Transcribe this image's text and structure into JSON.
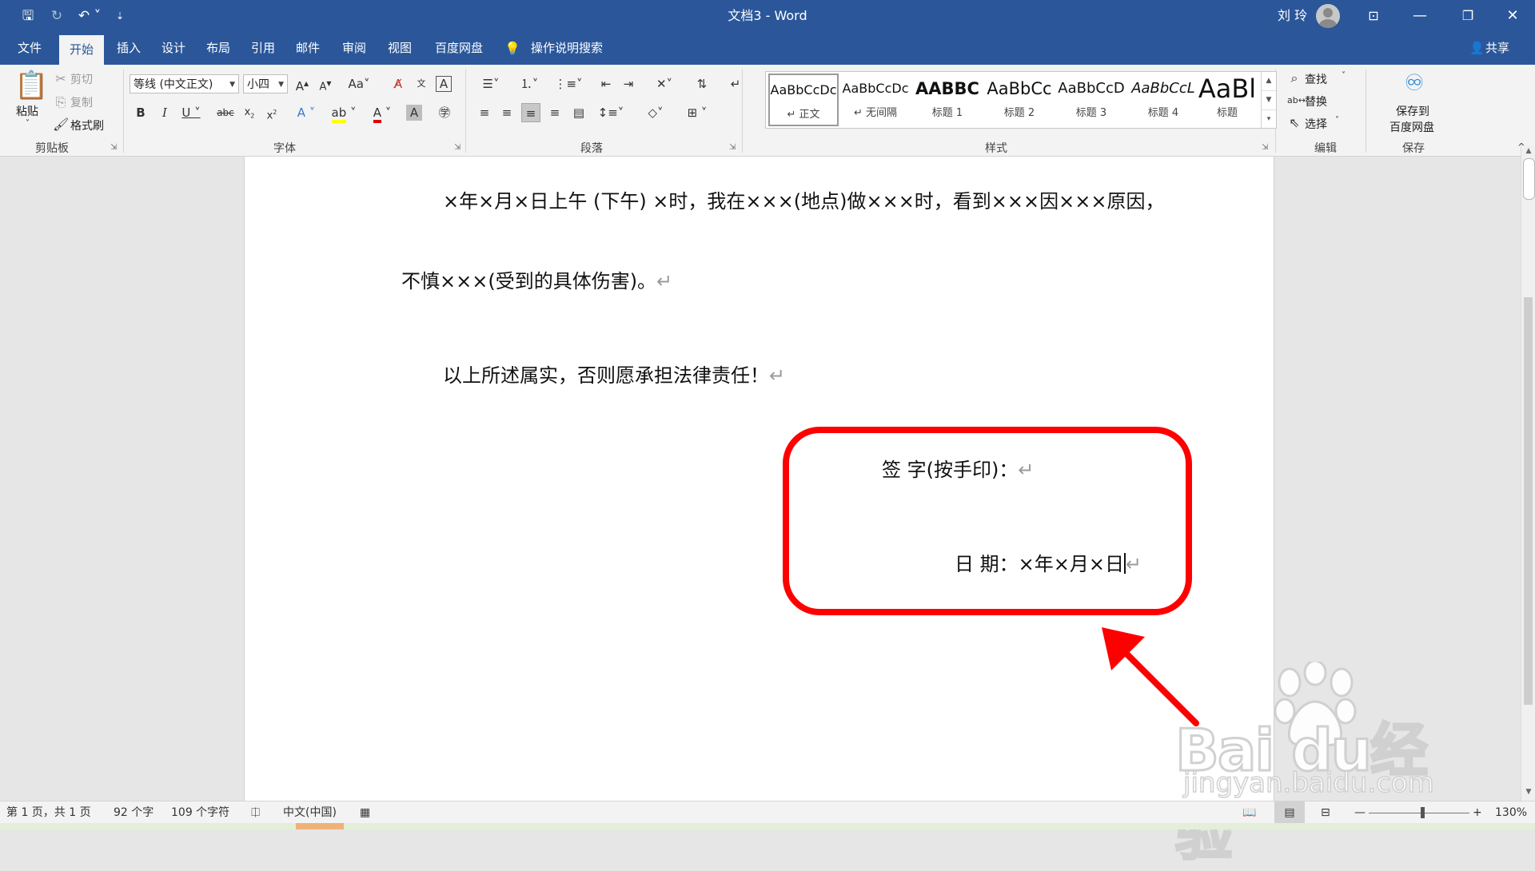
{
  "titlebar": {
    "title": "文档3  -  Word",
    "user": "刘 玲",
    "qat": [
      "save-icon",
      "autosave-icon",
      "undo-icon",
      "customize-icon"
    ],
    "qat_glyphs": {
      "save": "🖫",
      "autosave": "↻",
      "undo": "↶ ˅",
      "customize": "⇣"
    },
    "window_glyphs": {
      "ribbon_options": "⊡",
      "minimize": "—",
      "restore": "❐",
      "close": "✕"
    }
  },
  "tabs": {
    "items": [
      "文件",
      "开始",
      "插入",
      "设计",
      "布局",
      "引用",
      "邮件",
      "审阅",
      "视图",
      "百度网盘"
    ],
    "active": "开始",
    "tell_me": "操作说明搜索",
    "share": "共享"
  },
  "ribbon": {
    "clipboard": {
      "label": "剪贴板",
      "paste": "粘贴",
      "cut": "剪切",
      "copy": "复制",
      "format_painter": "格式刷"
    },
    "font": {
      "label": "字体",
      "font_name": "等线 (中文正文)",
      "font_size": "小四"
    },
    "paragraph": {
      "label": "段落"
    },
    "styles": {
      "label": "样式",
      "items": [
        {
          "preview": "AaBbCcDc",
          "name": "↵ 正文"
        },
        {
          "preview": "AaBbCcDc",
          "name": "↵ 无间隔"
        },
        {
          "preview": "AABBC",
          "name": "标题 1"
        },
        {
          "preview": "AaBbCc",
          "name": "标题 2"
        },
        {
          "preview": "AaBbCcD",
          "name": "标题 3"
        },
        {
          "preview": "AaBbCcL",
          "name": "标题 4"
        },
        {
          "preview": "AaBl",
          "name": "标题"
        }
      ]
    },
    "editing": {
      "label": "编辑",
      "find": "查找",
      "replace": "替换",
      "select": "选择"
    },
    "save": {
      "label": "保存",
      "save_to_line1": "保存到",
      "save_to_line2": "百度网盘"
    }
  },
  "document": {
    "line1": "×年×月×日上午 (下午) ×时，我在×××(地点)做×××时，看到×××因×××原因，",
    "line2": "不慎×××(受到的具体伤害)。",
    "line3": "以上所述属实，否则愿承担法律责任！",
    "signature": "签  字(按手印)：",
    "date": "日  期：×年×月×日",
    "para_mark": "↵"
  },
  "statusbar": {
    "page": "第 1 页，共 1 页",
    "words": "92 个字",
    "chars": "109 个字符",
    "language": "中文(中国)",
    "zoom_out": "—",
    "zoom_in": "+",
    "zoom": "130%",
    "zoom_level_percent": 130
  },
  "watermark": {
    "brand": "Bai  du经验",
    "url": "jingyan.baidu.com"
  },
  "colors": {
    "word_blue": "#2b579a",
    "annotation_red": "#ff0000"
  }
}
